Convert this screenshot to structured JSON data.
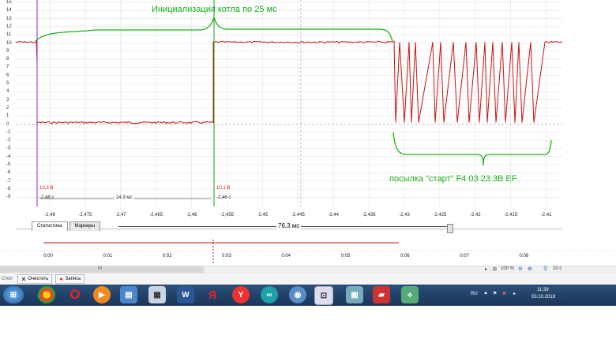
{
  "annotations": {
    "init": "Инициализация котла по 25 мс",
    "start_packet": "посылка \"старт\" F4 03 23 3B EF"
  },
  "y_axis_labels": [
    "15",
    "14",
    "13",
    "12",
    "11",
    "10",
    "9",
    "8",
    "7",
    "6",
    "5",
    "4",
    "3",
    "2",
    "1",
    "0",
    "-1",
    "-2",
    "-3",
    "-4",
    "-5",
    "-6",
    "-7",
    "-8",
    "-9"
  ],
  "x_axis_labels": [
    "-2,48",
    "-2,475",
    "-2,47",
    "-2,465",
    "-2,46",
    "-2,455",
    "-2,45",
    "-2,445",
    "-2,44",
    "-2,435",
    "-2,43",
    "-2,425",
    "-2,42",
    "-2,415",
    "-2,41"
  ],
  "markers": {
    "m1_volt": "10,3 В",
    "m1_time": "-2,48 с",
    "m2_volt": "10,1 В",
    "m2_time": "-2,46 с",
    "interval": "24,9 мс"
  },
  "tabs": {
    "statistics": "Статистика",
    "markers": "Маркеры"
  },
  "timebase_label": "76,3 мс",
  "overview_labels": [
    "0:00",
    "0:01",
    "0:02",
    "0:03",
    "0:04",
    "0:05",
    "0:06",
    "0:07",
    "0:08"
  ],
  "scrollbar_thumb": "III",
  "zoom": "100 %",
  "time_div": "10 с",
  "status_bar": {
    "stop": "Стоп",
    "clear": "Очистить",
    "record": "Запись"
  },
  "taskbar": {
    "lang": "RU",
    "time": "11:39",
    "date": "03.10.2018"
  },
  "colors": {
    "signal": "#cc1111",
    "annotation": "#18b018",
    "marker1": "#a020c0",
    "marker2": "#10a010"
  }
}
